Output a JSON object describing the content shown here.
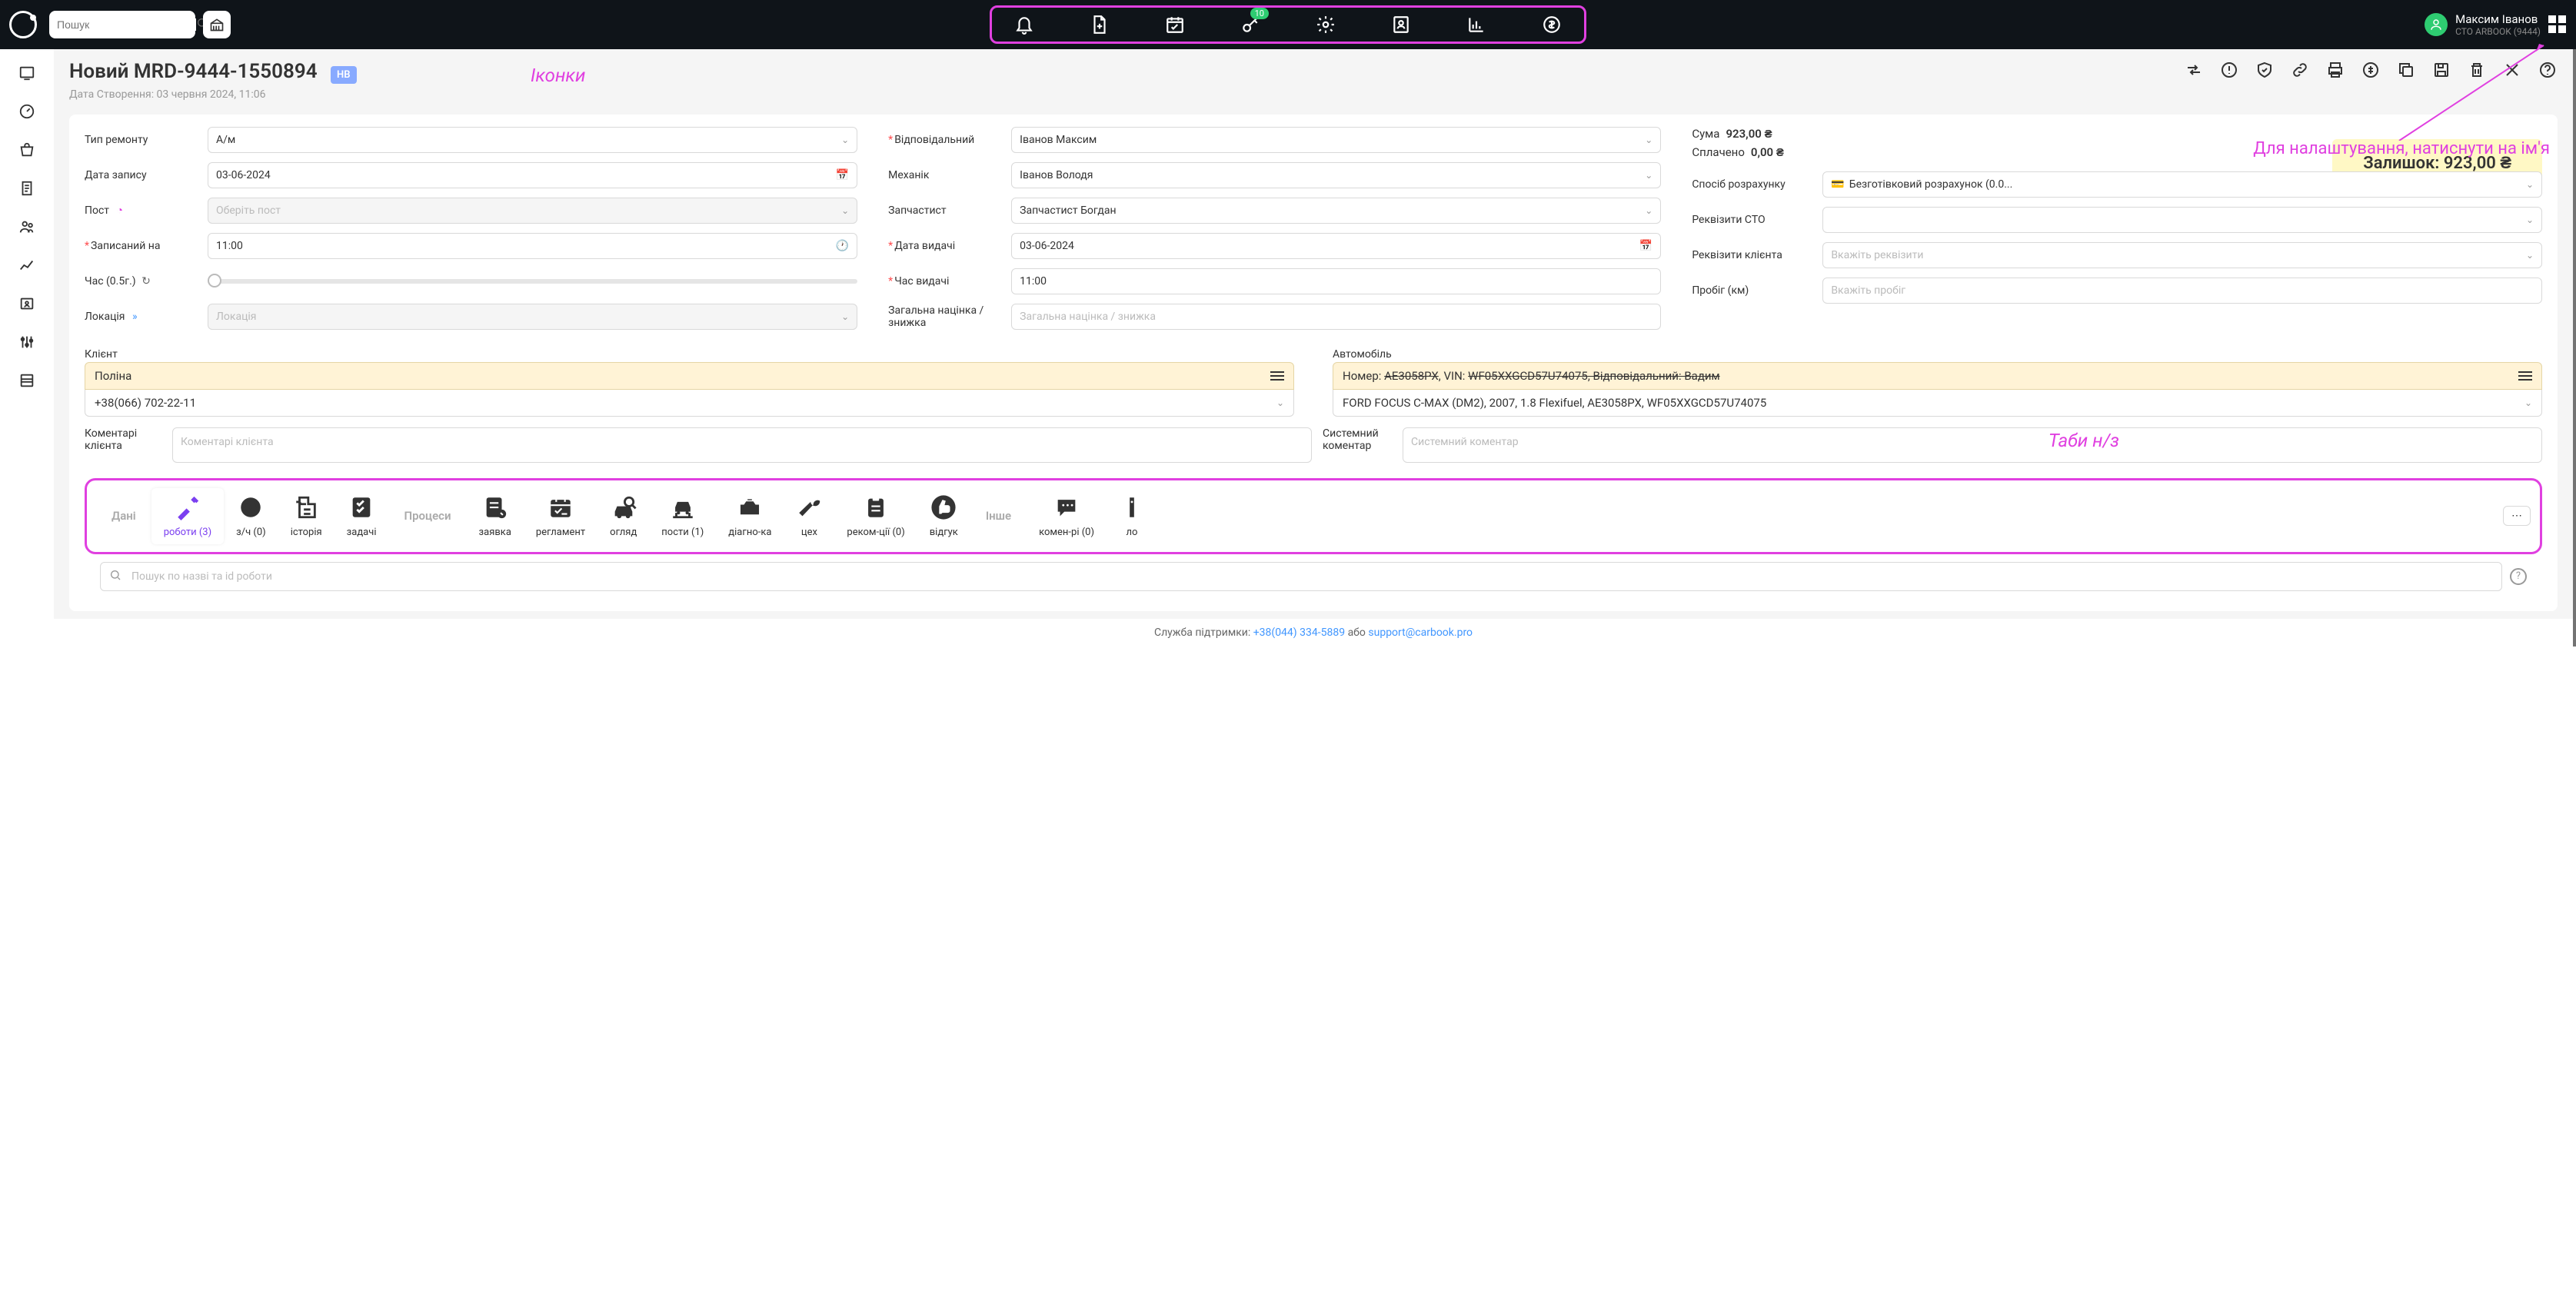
{
  "topbar": {
    "search_placeholder": "Пошук",
    "key_badge": "10",
    "user_name": "Максим Іванов",
    "user_sub": "CTO ARBOOK (9444)"
  },
  "page": {
    "title": "Новий MRD-9444-1550894",
    "badge": "НВ",
    "subtitle": "Дата Створення: 03 червня 2024, 11:06"
  },
  "form": {
    "col1": {
      "type_label": "Тип ремонту",
      "type_value": "А/м",
      "date_label": "Дата запису",
      "date_value": "03-06-2024",
      "post_label": "Пост",
      "post_placeholder": "Оберіть пост",
      "recorded_label": "Записаний на",
      "recorded_value": "11:00",
      "duration_label": "Час (0.5г.)",
      "location_label": "Локація",
      "location_placeholder": "Локація"
    },
    "col2": {
      "responsible_label": "Відповідальний",
      "responsible_value": "Іванов Максим",
      "mechanic_label": "Механік",
      "mechanic_value": "Іванов Володя",
      "parts_label": "Запчастист",
      "parts_value": "Запчастист Богдан",
      "release_date_label": "Дата видачі",
      "release_date_value": "03-06-2024",
      "release_time_label": "Час видачі",
      "release_time_value": "11:00",
      "markup_label": "Загальна націнка / знижка",
      "markup_placeholder": "Загальна націнка / знижка"
    },
    "col3": {
      "sum_label": "Сума",
      "sum_value": "923,00 ₴",
      "paid_label": "Сплачено",
      "paid_value": "0,00 ₴",
      "total": "Залишок: 923,00 ₴",
      "payment_label": "Спосіб розрахунку",
      "payment_value": "Безготівковий розрахунок (0.0...",
      "sto_label": "Реквізити СТО",
      "client_req_label": "Реквізити клієнта",
      "client_req_placeholder": "Вкажіть реквізити",
      "mileage_label": "Пробіг (км)",
      "mileage_placeholder": "Вкажіть пробіг"
    }
  },
  "client": {
    "label": "Клієнт",
    "name": "Поліна",
    "phone": "+38(066) 702-22-11",
    "comment_label": "Коментарі клієнта",
    "comment_placeholder": "Коментарі клієнта"
  },
  "vehicle": {
    "label": "Автомобіль",
    "row1_prefix": "Номер: ",
    "row1_number": "АЕ3058РХ",
    "row1_vin_label": ",  VIN: ",
    "row1_vin": "WF05XXGCD57U74075",
    "row1_resp": ",  Відповідальний: Вадим",
    "row2": "FORD FOCUS C-MAX (DM2), 2007, 1.8 Flexifuel, АЕ3058РХ, WF05XXGCD57U74075",
    "sys_label": "Системний коментар",
    "sys_placeholder": "Системний коментар"
  },
  "tabs": {
    "section1": "Дані",
    "works": "роботи (3)",
    "parts": "з/ч (0)",
    "history": "історія",
    "tasks": "задачі",
    "section2": "Процеси",
    "request": "заявка",
    "reglament": "регламент",
    "inspection": "огляд",
    "posts": "пости (1)",
    "diagcard": "діагно-ка",
    "workshop": "цех",
    "recom": "реком-ції (0)",
    "feedback": "відгук",
    "section3": "Інше",
    "comments": "комен-рі (0)",
    "logs": "ло"
  },
  "subsearch": {
    "placeholder": "Пошук по назві та id роботи"
  },
  "footer": {
    "prefix": "Служба підтримки: ",
    "phone": "+38(044) 334-5889",
    "mid": " або ",
    "email": "support@carbook.pro"
  },
  "annotations": {
    "icons": "Іконки",
    "settings": "Для налаштування, натиснути на ім'я",
    "tabs": "Таби н/з"
  }
}
